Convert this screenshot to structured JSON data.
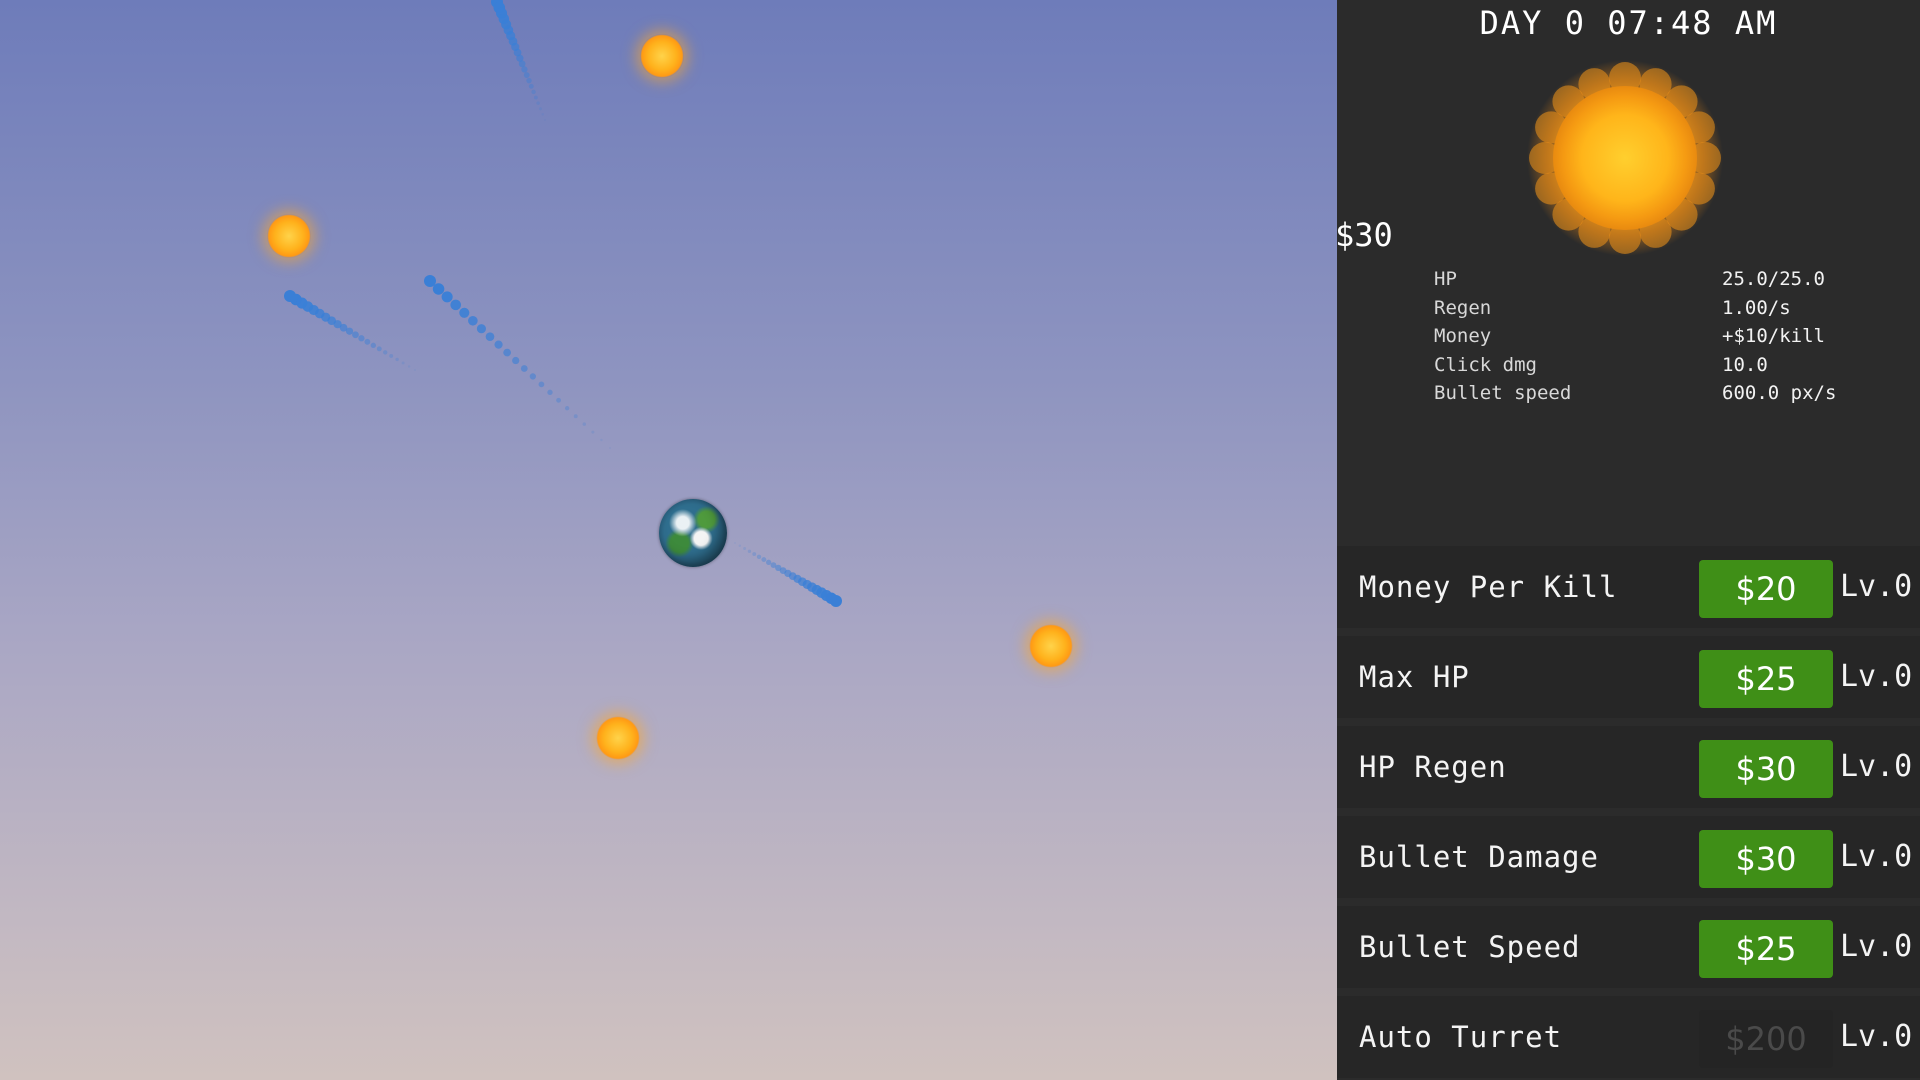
{
  "hud": {
    "clock": "DAY 0 07:48 AM",
    "money": "$30"
  },
  "stats": [
    {
      "label": "HP",
      "value": "25.0/25.0"
    },
    {
      "label": "Regen",
      "value": "1.00/s"
    },
    {
      "label": "Money",
      "value": "+$10/kill"
    },
    {
      "label": "Click dmg",
      "value": "10.0"
    },
    {
      "label": "Bullet speed",
      "value": "600.0 px/s"
    }
  ],
  "upgrades": [
    {
      "name": "Money Per Kill",
      "price": "$20",
      "level": "Lv.0",
      "affordable": true
    },
    {
      "name": "Max HP",
      "price": "$25",
      "level": "Lv.0",
      "affordable": true
    },
    {
      "name": "HP Regen",
      "price": "$30",
      "level": "Lv.0",
      "affordable": true
    },
    {
      "name": "Bullet Damage",
      "price": "$30",
      "level": "Lv.0",
      "affordable": true
    },
    {
      "name": "Bullet Speed",
      "price": "$25",
      "level": "Lv.0",
      "affordable": true
    },
    {
      "name": "Auto Turret",
      "price": "$200",
      "level": "Lv.0",
      "affordable": false
    }
  ],
  "colors": {
    "button_enabled": "#3f8f17",
    "button_disabled": "#242424",
    "panel_bg": "#2b2b2b",
    "sun": "#ffb21c",
    "trail": "#3a7fd6"
  },
  "icons": {
    "planet": "earth-icon",
    "enemy": "sun-enemy-icon",
    "time_of_day": "sun-icon"
  }
}
